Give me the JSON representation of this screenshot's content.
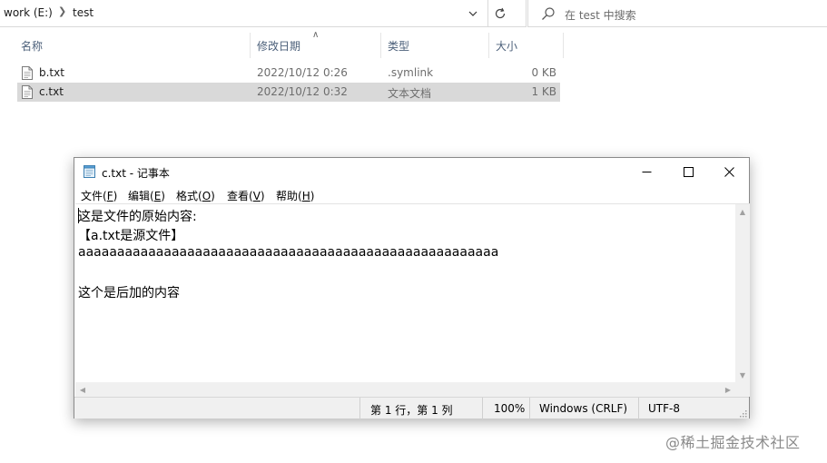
{
  "explorer": {
    "breadcrumb": {
      "drive": "work (E:)",
      "folder": "test"
    },
    "search": {
      "placeholder": "在 test 中搜索"
    },
    "columns": {
      "name": "名称",
      "date": "修改日期",
      "type": "类型",
      "size": "大小"
    },
    "files": [
      {
        "name": "b.txt",
        "date": "2022/10/12 0:26",
        "type": ".symlink",
        "size": "0 KB",
        "selected": false
      },
      {
        "name": "c.txt",
        "date": "2022/10/12 0:32",
        "type": "文本文档",
        "size": "1 KB",
        "selected": true
      }
    ]
  },
  "notepad": {
    "title": "c.txt - 记事本",
    "menu": {
      "file": {
        "label": "文件(",
        "key": "F",
        "close": ")"
      },
      "edit": {
        "label": "编辑(",
        "key": "E",
        "close": ")"
      },
      "format": {
        "label": "格式(",
        "key": "O",
        "close": ")"
      },
      "view": {
        "label": "查看(",
        "key": "V",
        "close": ")"
      },
      "help": {
        "label": "帮助(",
        "key": "H",
        "close": ")"
      }
    },
    "content": [
      "这是文件的原始内容:",
      "【a.txt是源文件】",
      "aaaaaaaaaaaaaaaaaaaaaaaaaaaaaaaaaaaaaaaaaaaaaaaaaaaaaa",
      "",
      "这个是后加的内容"
    ],
    "status": {
      "position": "第 1 行，第 1 列",
      "zoom": "100%",
      "line_ending": "Windows (CRLF)",
      "encoding": "UTF-8"
    }
  },
  "watermark": "@稀土掘金技术社区",
  "icons": {
    "search": "search-icon",
    "refresh": "refresh-icon",
    "dropdown": "chevron-down-icon",
    "breadcrumb_sep": "chevron-right-icon",
    "sort": "sort-up-icon",
    "file": "text-file-icon",
    "notepad": "notepad-icon",
    "minimize": "minimize-icon",
    "maximize": "maximize-icon",
    "close": "close-icon"
  },
  "colors": {
    "selection": "#d9d9d9",
    "column_header": "#4c607a",
    "statusbar": "#f0f0f0"
  }
}
